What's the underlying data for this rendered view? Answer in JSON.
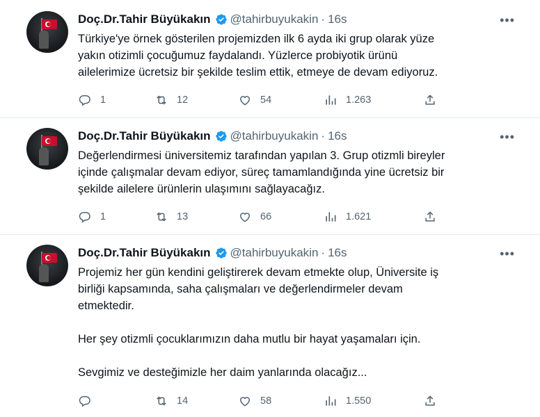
{
  "tweets": [
    {
      "name": "Doç.Dr.Tahir Büyükakın",
      "handle": "@tahirbuyukakin",
      "time": "16s",
      "lines": [
        "Türkiye'ye örnek gösterilen projemizden ilk 6 ayda iki grup olarak yüze",
        "yakın otizimli çocuğumuz faydalandı. Yüzlerce probiyotik ürünü",
        "ailelerimize ücretsiz bir şekilde teslim ettik, etmeye de devam ediyoruz."
      ],
      "replies": "1",
      "retweets": "12",
      "likes": "54",
      "views": "1.263"
    },
    {
      "name": "Doç.Dr.Tahir Büyükakın",
      "handle": "@tahirbuyukakin",
      "time": "16s",
      "lines": [
        "Değerlendirmesi üniversitemiz tarafından yapılan 3. Grup otizmli bireyler",
        "içinde çalışmalar devam ediyor, süreç tamamlandığında yine ücretsiz bir",
        "şekilde ailelere ürünlerin ulaşımını sağlayacağız."
      ],
      "replies": "1",
      "retweets": "13",
      "likes": "66",
      "views": "1.621"
    },
    {
      "name": "Doç.Dr.Tahir Büyükakın",
      "handle": "@tahirbuyukakin",
      "time": "16s",
      "lines": [
        "Projemiz her gün kendini geliştirerek devam etmekte olup, Üniversite iş",
        "birliği kapsamında, saha çalışmaları ve değerlendirmeler devam",
        "etmektedir.",
        "",
        "Her şey otizmli çocuklarımızın daha mutlu bir hayat yaşamaları için.",
        "",
        "Sevgimiz ve desteğimizle her daim yanlarında olacağız..."
      ],
      "replies": "",
      "retweets": "14",
      "likes": "58",
      "views": "1.550"
    }
  ],
  "icons": {
    "verified": "verified-badge-icon",
    "more": "more-icon",
    "reply": "reply-icon",
    "retweet": "retweet-icon",
    "like": "like-icon",
    "views": "views-icon",
    "share": "share-icon"
  },
  "colors": {
    "verified": "#1d9bf0",
    "text": "#0f1419",
    "muted": "#536471",
    "divider": "#e6ecf0"
  }
}
